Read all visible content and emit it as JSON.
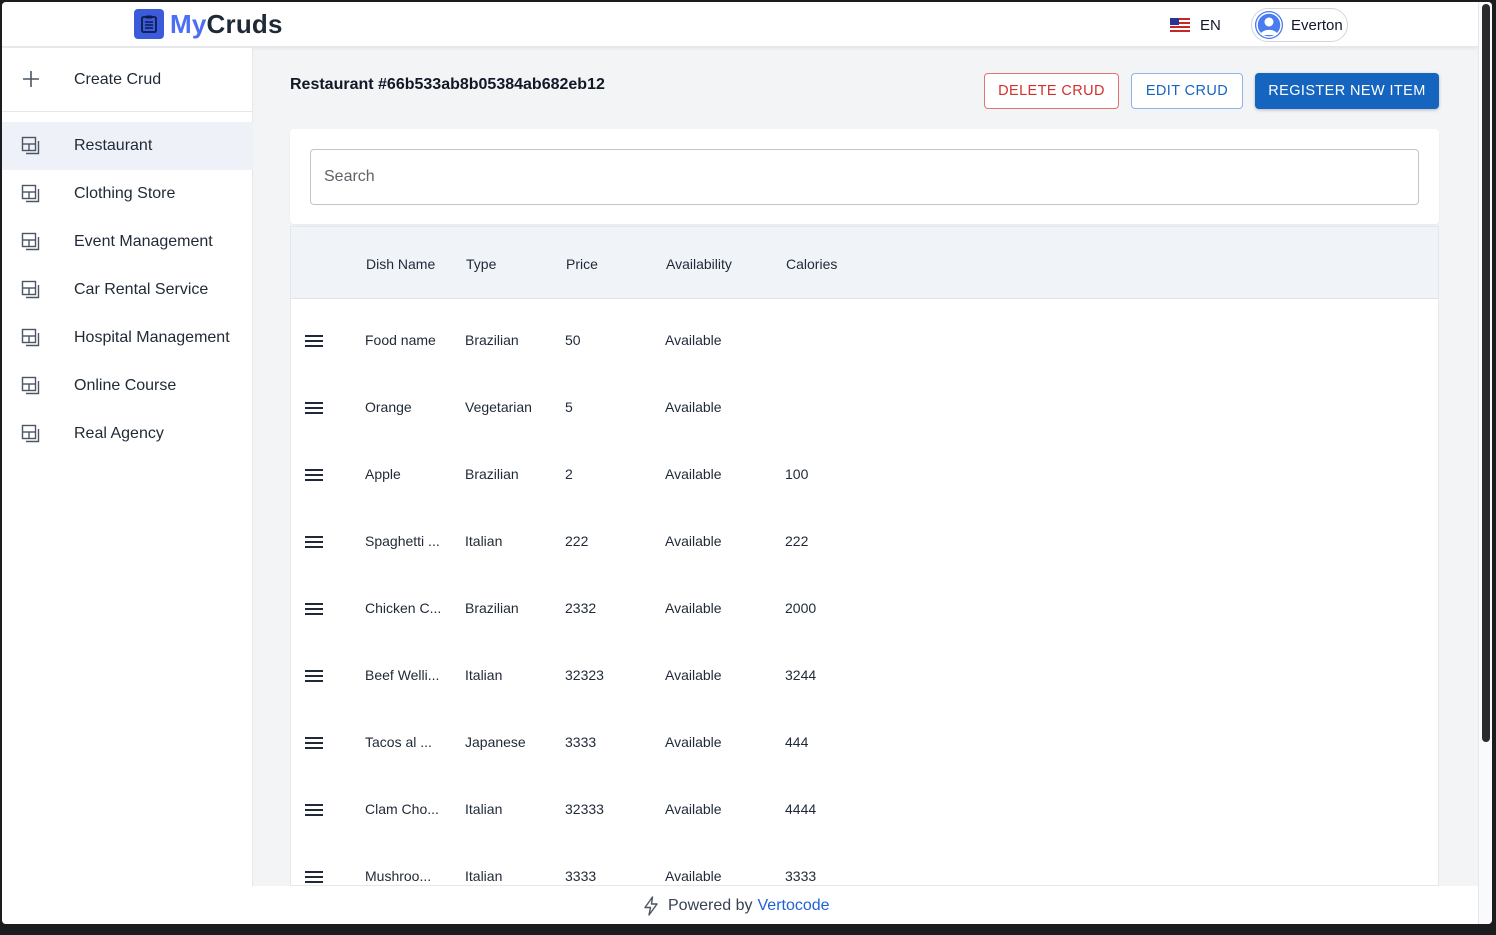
{
  "app": {
    "name_prefix": "My",
    "name_suffix": "Cruds",
    "language": "EN",
    "user_name": "Everton"
  },
  "sidebar": {
    "create_label": "Create Crud",
    "items": [
      {
        "label": "Restaurant",
        "active": true
      },
      {
        "label": "Clothing Store",
        "active": false
      },
      {
        "label": "Event Management",
        "active": false
      },
      {
        "label": "Car Rental Service",
        "active": false
      },
      {
        "label": "Hospital Management",
        "active": false
      },
      {
        "label": "Online Course",
        "active": false
      },
      {
        "label": "Real Agency",
        "active": false
      }
    ]
  },
  "main": {
    "title": "Restaurant #66b533ab8b05384ab682eb12",
    "buttons": {
      "delete": "DELETE CRUD",
      "edit": "EDIT CRUD",
      "register": "REGISTER NEW ITEM"
    },
    "search_placeholder": "Search",
    "table": {
      "columns": [
        "Dish Name",
        "Type",
        "Price",
        "Availability",
        "Calories"
      ],
      "rows": [
        [
          "Food name",
          "Brazilian",
          "50",
          "Available",
          ""
        ],
        [
          "Orange",
          "Vegetarian",
          "5",
          "Available",
          ""
        ],
        [
          "Apple",
          "Brazilian",
          "2",
          "Available",
          "100"
        ],
        [
          "Spaghetti ...",
          "Italian",
          "222",
          "Available",
          "222"
        ],
        [
          "Chicken C...",
          "Brazilian",
          "2332",
          "Available",
          "2000"
        ],
        [
          "Beef Welli...",
          "Italian",
          "32323",
          "Available",
          "3244"
        ],
        [
          "Tacos al ...",
          "Japanese",
          "3333",
          "Available",
          "444"
        ],
        [
          "Clam Cho...",
          "Italian",
          "32333",
          "Available",
          "4444"
        ],
        [
          "Mushroo...",
          "Italian",
          "3333",
          "Available",
          "3333"
        ]
      ]
    }
  },
  "footer": {
    "text": "Powered by",
    "link": "Vertocode"
  },
  "colors": {
    "accent": "#1565c0",
    "danger": "#d32f2f",
    "logo": "#4c6ef5"
  }
}
